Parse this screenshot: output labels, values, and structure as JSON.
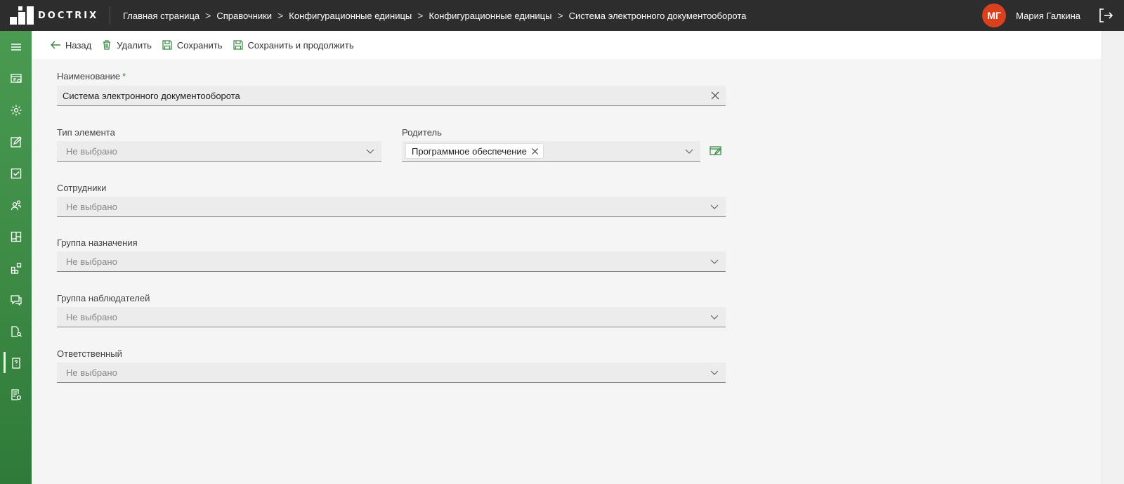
{
  "app": {
    "logo_text": "DOCTRIX"
  },
  "breadcrumb": [
    "Главная страница",
    "Справочники",
    "Конфигурационные единицы",
    "Конфигурационные единицы",
    "Система электронного документооборота"
  ],
  "breadcrumb_separator": ">",
  "user": {
    "initials": "МГ",
    "name": "Мария Галкина",
    "avatar_color": "#d8401e"
  },
  "sidebar": {
    "items": [
      {
        "icon": "menu-icon"
      },
      {
        "icon": "board-icon"
      },
      {
        "icon": "gear-icon"
      },
      {
        "icon": "edit-icon"
      },
      {
        "icon": "checkbox-icon"
      },
      {
        "icon": "users-icon"
      },
      {
        "icon": "layout-icon"
      },
      {
        "icon": "widgets-icon"
      },
      {
        "icon": "chat-icon"
      },
      {
        "icon": "document-search-icon"
      },
      {
        "icon": "help-document-icon",
        "active": true
      },
      {
        "icon": "report-icon"
      }
    ],
    "accent_color": "#3c8a44"
  },
  "toolbar": {
    "back_label": "Назад",
    "delete_label": "Удалить",
    "save_label": "Сохранить",
    "save_continue_label": "Сохранить и продолжить"
  },
  "form": {
    "name": {
      "label": "Наименование",
      "required_mark": "*",
      "value": "Система электронного документооборота"
    },
    "element_type": {
      "label": "Тип элемента",
      "placeholder": "Не выбрано"
    },
    "parent": {
      "label": "Родитель",
      "chip": "Программное обеспечение"
    },
    "employees": {
      "label": "Сотрудники",
      "placeholder": "Не выбрано"
    },
    "assignment_group": {
      "label": "Группа назначения",
      "placeholder": "Не выбрано"
    },
    "observers_group": {
      "label": "Группа наблюдателей",
      "placeholder": "Не выбрано"
    },
    "responsible": {
      "label": "Ответственный",
      "placeholder": "Не выбрано"
    }
  }
}
